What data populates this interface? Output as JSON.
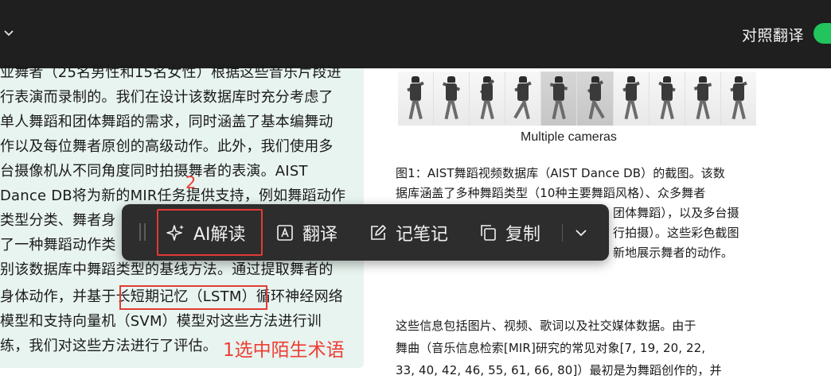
{
  "topbar": {
    "compare_label": "对照翻译",
    "toggle_color": "#21c45d"
  },
  "translation": {
    "lines": [
      "业舞者（25名男性和15名女性）根据这些音乐片段进",
      "行表演而录制的。我们在设计该数据库时充分考虑了",
      "单人舞蹈和团体舞蹈的需求，同时涵盖了基本编舞动",
      "作以及每位舞者原创的高级动作。此外，我们使用多",
      "台摄像机从不同角度同时拍摄舞者的表演。AIST",
      "Dance DB将为新的MIR任务提供支持，例如舞蹈动作",
      "类型分类、舞者身",
      "了一种舞蹈动作类",
      "别该数据库中舞蹈类型的基线方法。通过提取舞者的",
      "身体动作，并基于长短期记忆（LSTM）循环神经网络",
      "模型和支持向量机（SVM）模型对这些方法进行训",
      "练，我们对这些方法进行了评估。"
    ],
    "selected_term": "长短期记忆（LSTM）",
    "selection_color": "#e23b35"
  },
  "annotations": {
    "step1": "1选中陌生术语",
    "step2": "2",
    "color": "#ee3d35"
  },
  "figure": {
    "caption": "Multiple cameras",
    "frame_count": 10
  },
  "original": {
    "figure_lines": [
      "图1：AIST舞蹈视频数据库（AIST Dance DB）的截图。该数",
      "据库涵盖了多种舞蹈类型（10种主要舞蹈风格）、众多舞者",
      "团体舞蹈），以及多台摄",
      "行拍摄）。这些彩色截图",
      "新地展示舞者的动作。"
    ],
    "body_lines": [
      "这些信息包括图片、视频、歌词以及社交媒体数据。由于",
      "舞曲（音乐信息检索[MIR]研究的常见对象[7, 19, 20, 22,",
      "33, 40, 42, 46, 55, 61, 66, 80]）最初是为舞蹈创作的，并"
    ]
  },
  "toolbar": {
    "ai_label": "AI解读",
    "translate_label": "翻译",
    "notes_label": "记笔记",
    "copy_label": "复制",
    "icons": [
      "sparkle-icon",
      "translate-icon",
      "edit-note-icon",
      "copy-icon",
      "chevron-down-icon"
    ]
  }
}
